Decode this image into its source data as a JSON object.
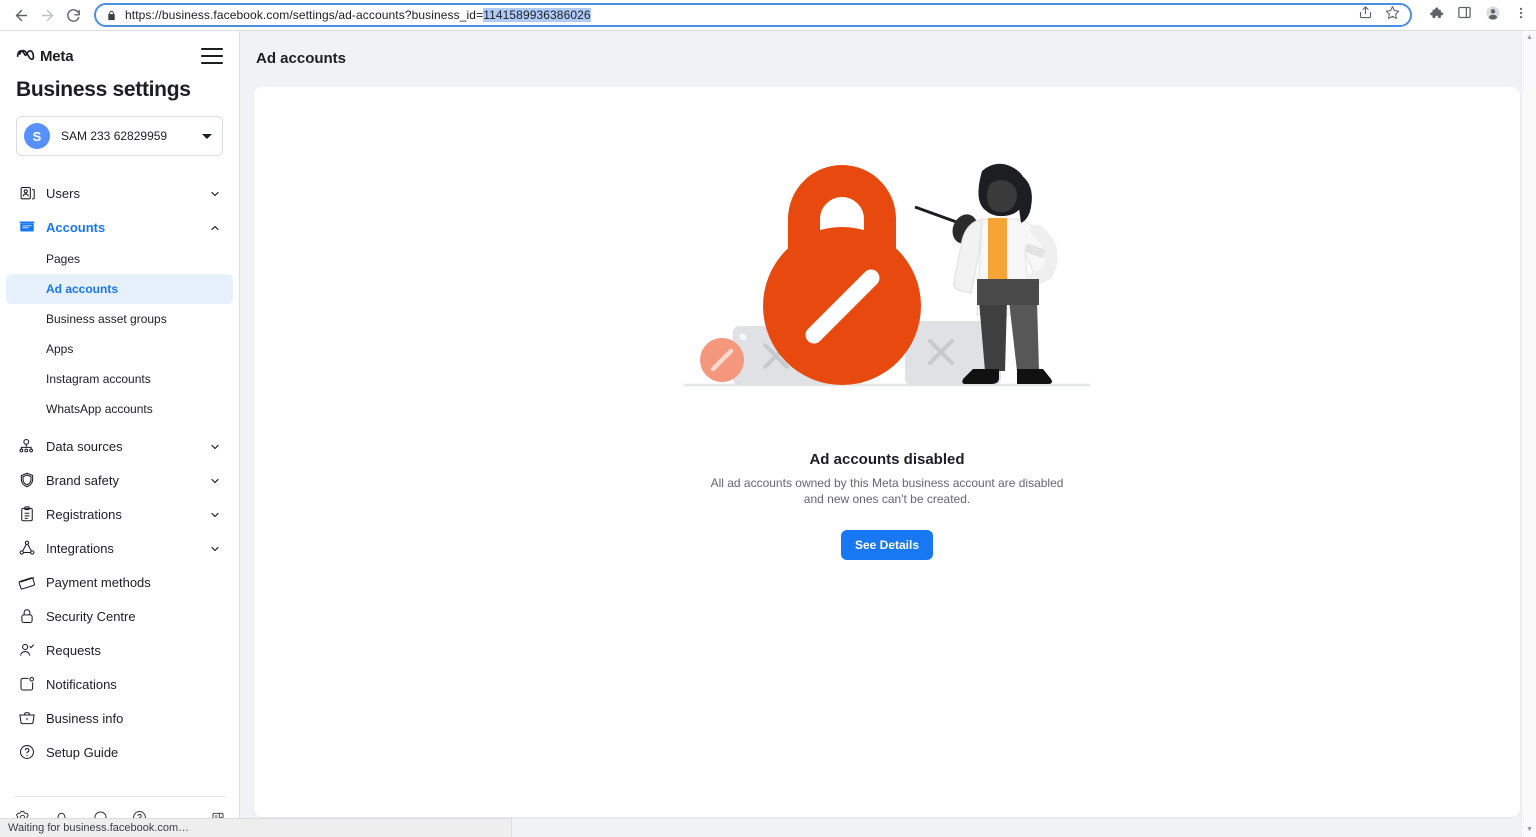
{
  "browser": {
    "back_label": "Back",
    "forward_label": "Forward",
    "reload_label": "Reload",
    "url_prefix": "https://business.facebook.com/settings/ad-accounts?business_id=",
    "url_selected": "1141589936386026",
    "url_full": "https://business.facebook.com/settings/ad-accounts?business_id=1141589936386026",
    "lock_icon": "lock-icon",
    "share_icon": "share-icon",
    "bookmark_icon": "star-icon",
    "extensions_icon": "puzzle-piece-icon",
    "sidepanel_icon": "side-panel-icon",
    "profile_icon": "profile-avatar-icon",
    "menu_icon": "three-dot-menu-icon",
    "status_text": "Waiting for business.facebook.com…"
  },
  "sidebar": {
    "brand": "Meta",
    "title": "Business settings",
    "menu_icon": "hamburger-icon",
    "account": {
      "initial": "S",
      "name": "SAM 233 62829959",
      "caret_icon": "chevron-down-icon"
    },
    "items": [
      {
        "label": "Users",
        "icon": "users-card-icon",
        "expandable": true,
        "expanded": false,
        "chevron": "chevron-down-icon"
      },
      {
        "label": "Accounts",
        "icon": "ad-account-icon",
        "expandable": true,
        "expanded": true,
        "chevron": "chevron-up-icon",
        "active": true
      },
      {
        "label": "Data sources",
        "icon": "data-sources-icon",
        "expandable": true,
        "expanded": false,
        "chevron": "chevron-down-icon"
      },
      {
        "label": "Brand safety",
        "icon": "shield-icon",
        "expandable": true,
        "expanded": false,
        "chevron": "chevron-down-icon"
      },
      {
        "label": "Registrations",
        "icon": "clipboard-icon",
        "expandable": true,
        "expanded": false,
        "chevron": "chevron-down-icon"
      },
      {
        "label": "Integrations",
        "icon": "integrations-node-icon",
        "expandable": true,
        "expanded": false,
        "chevron": "chevron-down-icon"
      },
      {
        "label": "Payment methods",
        "icon": "credit-card-icon",
        "expandable": false
      },
      {
        "label": "Security Centre",
        "icon": "lock-icon",
        "expandable": false
      },
      {
        "label": "Requests",
        "icon": "user-check-icon",
        "expandable": false
      },
      {
        "label": "Notifications",
        "icon": "notification-bell-icon",
        "expandable": false
      },
      {
        "label": "Business info",
        "icon": "briefcase-icon",
        "expandable": false
      },
      {
        "label": "Setup Guide",
        "icon": "question-circle-icon",
        "expandable": false
      }
    ],
    "sub_items": [
      {
        "label": "Pages",
        "selected": false
      },
      {
        "label": "Ad accounts",
        "selected": true
      },
      {
        "label": "Business asset groups",
        "selected": false
      },
      {
        "label": "Apps",
        "selected": false
      },
      {
        "label": "Instagram accounts",
        "selected": false
      },
      {
        "label": "WhatsApp accounts",
        "selected": false
      }
    ],
    "footer_icons": [
      "settings-gear-icon",
      "notifications-bell-icon",
      "messenger-chat-icon",
      "help-question-icon",
      "collapse-panel-icon"
    ]
  },
  "main": {
    "page_title": "Ad accounts",
    "empty_state": {
      "illustration": "disabled-padlock-illustration",
      "title": "Ad accounts disabled",
      "description": "All ad accounts owned by this Meta business account are disabled and new ones can't be created.",
      "button_label": "See Details"
    }
  },
  "colors": {
    "brand_blue": "#1877f2",
    "accent_red": "#e8490f",
    "selected_nav_bg": "#e7f0fd",
    "page_bg": "#f0f2f5",
    "url_selection": "#aecbfa"
  }
}
